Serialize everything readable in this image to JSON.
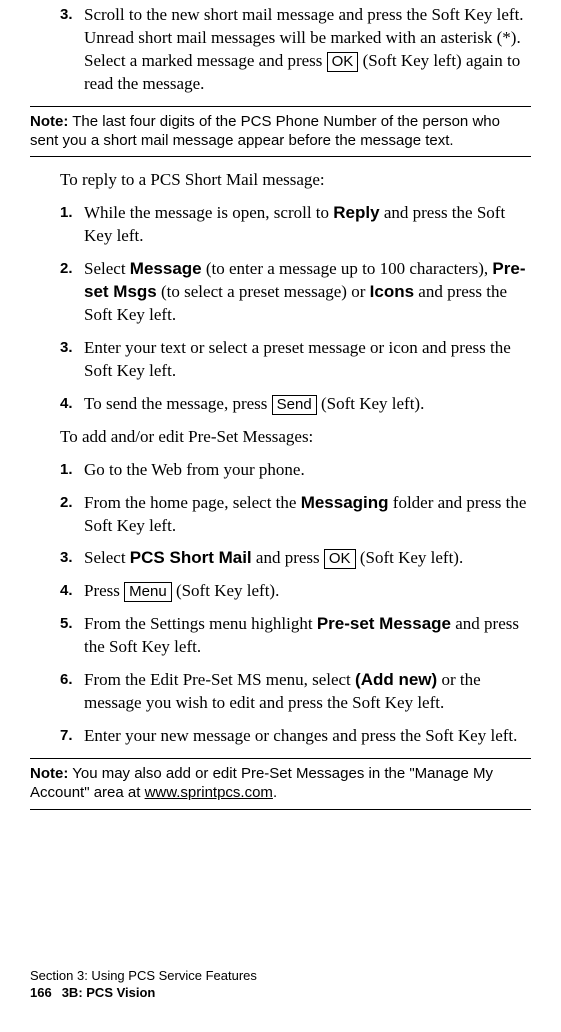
{
  "topItem": {
    "num": "3.",
    "textA": "Scroll to the new short mail message and press the Soft Key left. Unread short mail messages will be marked with an asterisk (*). Select a marked message and press ",
    "key": "OK",
    "textB": " (Soft Key left) again to read the message."
  },
  "note1": {
    "label": "Note:",
    "text": " The last four digits of the PCS Phone Number of the person who sent you a short mail message appear before the message text."
  },
  "replyIntro": "To reply to a PCS Short Mail message:",
  "replyList": {
    "i1": {
      "num": "1.",
      "a": "While the message is open, scroll to ",
      "b": "Reply",
      "c": " and press the Soft Key left."
    },
    "i2": {
      "num": "2.",
      "a": "Select ",
      "b": "Message",
      "c": " (to enter a message up to 100 characters), ",
      "d": "Pre-set Msgs",
      "e": " (to select a preset message) or ",
      "f": "Icons",
      "g": " and press the Soft Key left."
    },
    "i3": {
      "num": "3.",
      "a": "Enter your text or select a preset message or icon and press the Soft Key left."
    },
    "i4": {
      "num": "4.",
      "a": "To send the message, press ",
      "key": "Send",
      "b": " (Soft Key left)."
    }
  },
  "presetIntro": "To add and/or edit Pre-Set Messages:",
  "presetList": {
    "i1": {
      "num": "1.",
      "a": "Go to the Web from your phone."
    },
    "i2": {
      "num": "2.",
      "a": "From the home page, select the ",
      "b": "Messaging",
      "c": " folder and press the Soft Key left."
    },
    "i3": {
      "num": "3.",
      "a": "Select ",
      "b": "PCS Short Mail",
      "c": " and press ",
      "key": "OK",
      "d": " (Soft Key left)."
    },
    "i4": {
      "num": "4.",
      "a": "Press ",
      "key": "Menu",
      "b": " (Soft Key left)."
    },
    "i5": {
      "num": "5.",
      "a": "From the Settings menu highlight ",
      "b": "Pre-set Message",
      "c": " and press the Soft Key left."
    },
    "i6": {
      "num": "6.",
      "a": "From the Edit Pre-Set MS menu, select ",
      "b": "(Add new)",
      "c": " or the message you wish to edit and press the Soft Key left."
    },
    "i7": {
      "num": "7.",
      "a": "Enter your new message or changes and press the Soft Key left."
    }
  },
  "note2": {
    "label": "Note:",
    "a": " You may also add or edit Pre-Set Messages in the \"Manage My Account\" area at ",
    "url": "www.sprintpcs.com",
    "b": "."
  },
  "footer": {
    "line1": "Section 3: Using PCS Service Features",
    "pageNum": "166",
    "line2": "3B: PCS Vision"
  }
}
